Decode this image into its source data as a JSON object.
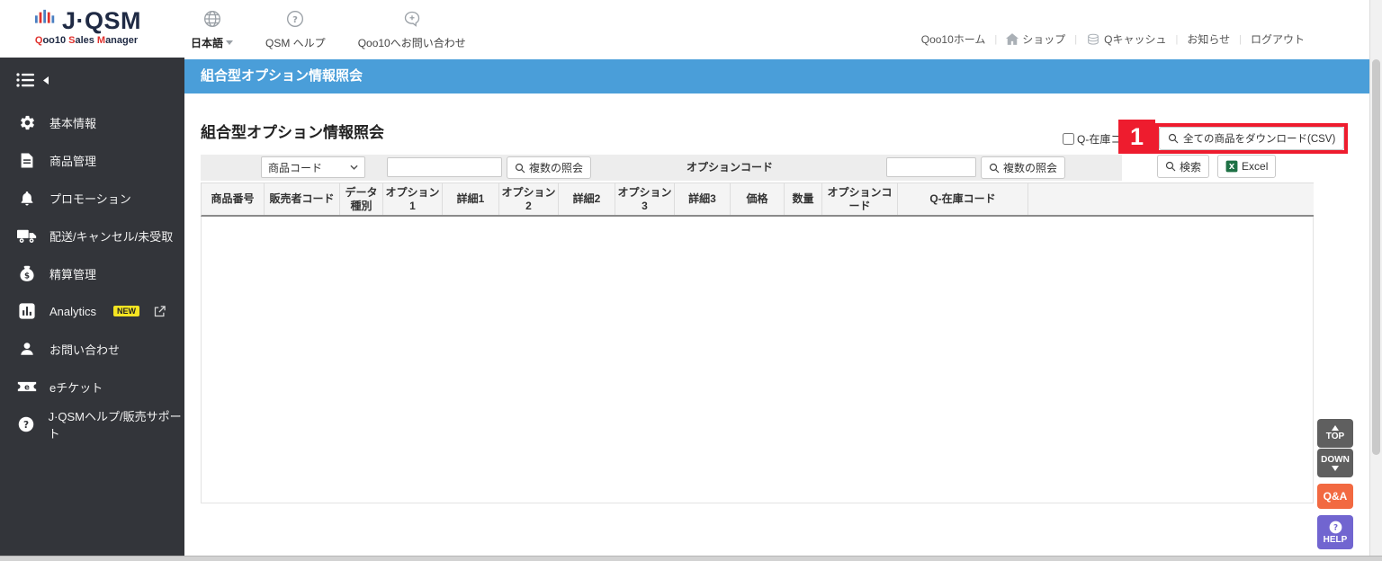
{
  "header": {
    "logo": {
      "name": "J·QSM",
      "sub_words": [
        "Qoo10",
        "Sales",
        "Manager"
      ]
    },
    "nav": {
      "language": "日本語",
      "qsm_help": "QSM ヘルプ",
      "contact": "Qoo10へお問い合わせ"
    },
    "links": {
      "home": "Qoo10ホーム",
      "shop": "ショップ",
      "qcash": "Qキャッシュ",
      "notice": "お知らせ",
      "logout": "ログアウト",
      "separator": "|"
    }
  },
  "sidebar": {
    "items": [
      {
        "label": "基本情報"
      },
      {
        "label": "商品管理"
      },
      {
        "label": "プロモーション"
      },
      {
        "label": "配送/キャンセル/未受取"
      },
      {
        "label": "精算管理"
      },
      {
        "label": "Analytics",
        "badge": "NEW"
      },
      {
        "label": "お問い合わせ"
      },
      {
        "label": "eチケット"
      },
      {
        "label": "J·QSMヘルプ/販売サポート"
      }
    ]
  },
  "page": {
    "titlebar": "組合型オプション情報照会",
    "heading": "組合型オプション情報照会"
  },
  "toolbar": {
    "stock_checkbox_label": "Q-在庫コー",
    "annotation_badge": "1",
    "download_csv_label": "全ての商品をダウンロード(CSV)"
  },
  "search": {
    "field_select_value": "商品コード",
    "multi_search_label": "複数の照会",
    "option_code_label": "オプションコード",
    "multi_search_label2": "複数の照会",
    "search_label": "検索",
    "excel_label": "Excel"
  },
  "table": {
    "headers": [
      "商品番号",
      "販売者コード",
      "データ種別",
      "オプション1",
      "詳細1",
      "オプション2",
      "詳細2",
      "オプション3",
      "詳細3",
      "価格",
      "数量",
      "オプションコード",
      "Q-在庫コード"
    ]
  },
  "floating": {
    "top": "TOP",
    "down": "DOWN",
    "qa": "Q&A",
    "help": "HELP"
  },
  "colors": {
    "accent_blue": "#4a9ed9",
    "annotation_red": "#ee1c2e",
    "qa_orange": "#f26941",
    "help_purple": "#7165d0",
    "sidebar_dark": "#33353a",
    "excel_green": "#1e7145"
  }
}
